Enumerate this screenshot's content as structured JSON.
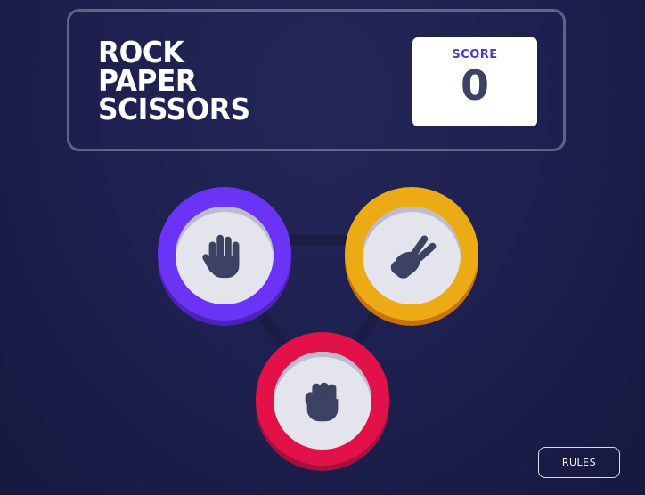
{
  "header": {
    "title_lines": [
      "ROCK",
      "PAPER",
      "SCISSORS"
    ],
    "score_label": "SCORE",
    "score_value": "0"
  },
  "choices": [
    {
      "name": "paper",
      "color": "#6a33f5"
    },
    {
      "name": "scissors",
      "color": "#ecaa14"
    },
    {
      "name": "rock",
      "color": "#e2114a"
    }
  ],
  "rules_label": "RULES"
}
